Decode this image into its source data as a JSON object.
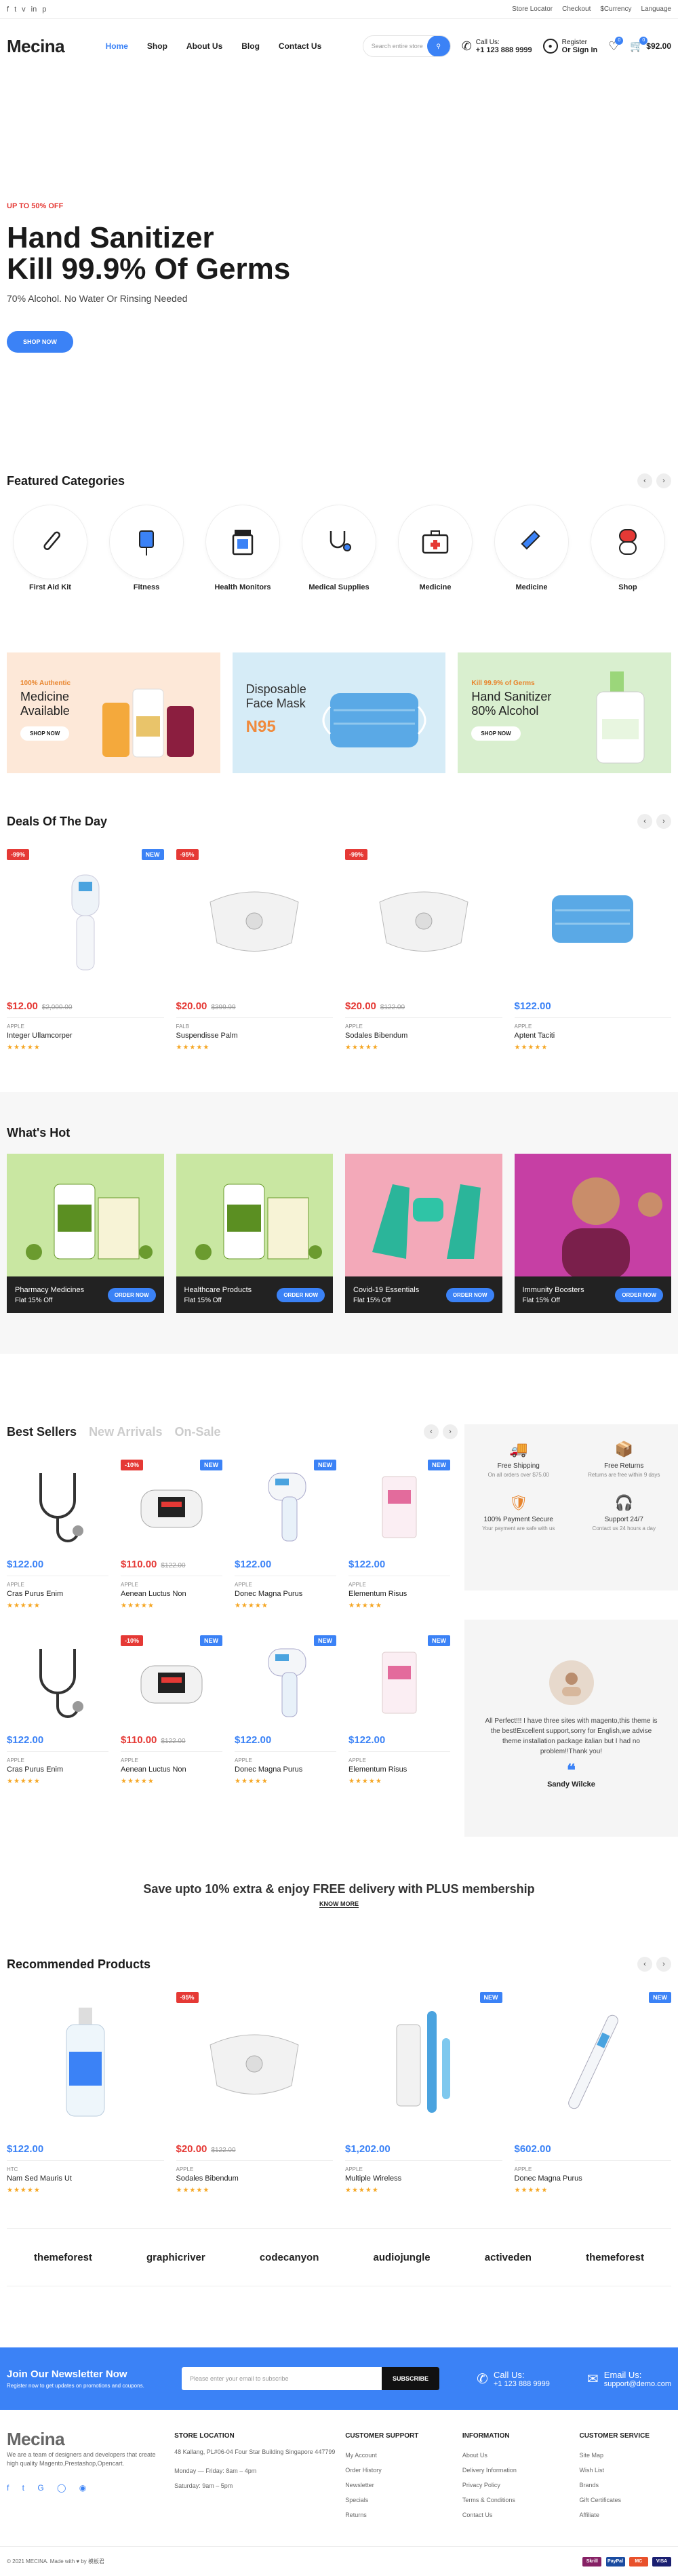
{
  "topbar": {
    "social": [
      "f",
      "t",
      "v",
      "in",
      "p"
    ],
    "store_locator": "Store Locator",
    "checkout": "Checkout",
    "currency": "$Currency",
    "language": "Language"
  },
  "header": {
    "logo": "Mecina",
    "nav": [
      "Home",
      "Shop",
      "About Us",
      "Blog",
      "Contact Us"
    ],
    "search_placeholder": "Search entire store",
    "call_label": "Call Us:",
    "phone": "+1 123 888 9999",
    "register": "Register",
    "signin": "Or Sign In",
    "wishlist_count": "0",
    "cart_count": "0",
    "cart_total": "$92.00"
  },
  "hero": {
    "tag": "UP TO 50% OFF",
    "line1": "Hand Sanitizer",
    "line2": "Kill 99.9% Of Germs",
    "sub": "70% Alcohol. No Water Or Rinsing Needed",
    "button": "SHOP NOW"
  },
  "categories": {
    "title": "Featured Categories",
    "items": [
      "First Aid Kit",
      "Fitness",
      "Health Monitors",
      "Medical Supplies",
      "Medicine",
      "Medicine",
      "Shop"
    ]
  },
  "banners": [
    {
      "tag": "100% Authentic",
      "title": "Medicine Available",
      "button": "SHOP NOW",
      "bg": "#fde8d8"
    },
    {
      "tag": "",
      "title": "Disposable Face Mask",
      "extra": "N95",
      "button": "",
      "bg": "#d6ecf7"
    },
    {
      "tag": "Kill 99.9% of Germs",
      "title": "Hand Sanitizer 80% Alcohol",
      "button": "SHOP NOW",
      "bg": "#d9efcf"
    }
  ],
  "deals": {
    "title": "Deals Of The Day",
    "items": [
      {
        "sale": "-99%",
        "new": "NEW",
        "price": "$12.00",
        "old": "$2,000.00",
        "cat": "APPLE",
        "name": "Integer Ullamcorper",
        "stars": "★★★★★"
      },
      {
        "sale": "-95%",
        "new": "",
        "price": "$20.00",
        "old": "$399.99",
        "cat": "FALB",
        "name": "Suspendisse Palm",
        "stars": "★★★★★"
      },
      {
        "sale": "-99%",
        "new": "",
        "price": "$20.00",
        "old": "$122.00",
        "cat": "APPLE",
        "name": "Sodales Bibendum",
        "stars": "★★★★★"
      },
      {
        "sale": "",
        "new": "",
        "price": "$122.00",
        "old": "",
        "cat": "APPLE",
        "name": "Aptent Taciti",
        "stars": "★★★★★"
      }
    ]
  },
  "hot": {
    "title": "What's Hot",
    "items": [
      {
        "name": "Pharmacy Medicines",
        "off": "Flat 15% Off",
        "button": "ORDER NOW",
        "bg": "#c9e7a2"
      },
      {
        "name": "Healthcare Products",
        "off": "Flat 15% Off",
        "button": "ORDER NOW",
        "bg": "#c9e7a2"
      },
      {
        "name": "Covid-19 Essentials",
        "off": "Flat 15% Off",
        "button": "ORDER NOW",
        "bg": "#f3a9b9"
      },
      {
        "name": "Immunity Boosters",
        "off": "Flat 15% Off",
        "button": "ORDER NOW",
        "bg": "#c63fa4"
      }
    ]
  },
  "bestsellers": {
    "tabs": [
      "Best Sellers",
      "New Arrivals",
      "On-Sale"
    ],
    "items": [
      {
        "sale": "",
        "new": "",
        "price": "$122.00",
        "old": "",
        "cat": "APPLE",
        "name": "Cras Purus Enim",
        "stars": "★★★★★"
      },
      {
        "sale": "-10%",
        "new": "NEW",
        "price": "$110.00",
        "old": "$122.00",
        "cat": "APPLE",
        "name": "Aenean Luctus Non",
        "stars": "★★★★★"
      },
      {
        "sale": "",
        "new": "NEW",
        "price": "$122.00",
        "old": "",
        "cat": "APPLE",
        "name": "Donec Magna Purus",
        "stars": "★★★★★"
      },
      {
        "sale": "",
        "new": "NEW",
        "price": "$122.00",
        "old": "",
        "cat": "APPLE",
        "name": "Elementum Risus",
        "stars": "★★★★★"
      },
      {
        "sale": "",
        "new": "",
        "price": "$122.00",
        "old": "",
        "cat": "APPLE",
        "name": "Cras Purus Enim",
        "stars": "★★★★★"
      },
      {
        "sale": "-10%",
        "new": "NEW",
        "price": "$110.00",
        "old": "$122.00",
        "cat": "APPLE",
        "name": "Aenean Luctus Non",
        "stars": "★★★★★"
      },
      {
        "sale": "",
        "new": "NEW",
        "price": "$122.00",
        "old": "",
        "cat": "APPLE",
        "name": "Donec Magna Purus",
        "stars": "★★★★★"
      },
      {
        "sale": "",
        "new": "NEW",
        "price": "$122.00",
        "old": "",
        "cat": "APPLE",
        "name": "Elementum Risus",
        "stars": "★★★★★"
      }
    ]
  },
  "services": [
    {
      "title": "Free Shipping",
      "sub": "On all orders over $75.00"
    },
    {
      "title": "Free Returns",
      "sub": "Returns are free within 9 days"
    },
    {
      "title": "100% Payment Secure",
      "sub": "Your payment are safe with us"
    },
    {
      "title": "Support 24/7",
      "sub": "Contact us 24 hours a day"
    }
  ],
  "testimonial": {
    "text": "All Perfect!!! I have three sites with magento,this theme is the best!Excellent support,sorry for English,we advise theme installation package italian but I had no problem!!Thank you!",
    "name": "Sandy Wilcke"
  },
  "promo": {
    "text": "Save upto 10% extra & enjoy FREE delivery with PLUS membership",
    "link": "KNOW MORE"
  },
  "recommended": {
    "title": "Recommended Products",
    "items": [
      {
        "sale": "",
        "new": "",
        "price": "$122.00",
        "old": "",
        "cat": "HTC",
        "name": "Nam Sed Mauris Ut",
        "stars": "★★★★★"
      },
      {
        "sale": "-95%",
        "new": "",
        "price": "$20.00",
        "old": "$122.00",
        "cat": "APPLE",
        "name": "Sodales Bibendum",
        "stars": "★★★★★"
      },
      {
        "sale": "",
        "new": "NEW",
        "price": "$1,202.00",
        "old": "",
        "cat": "APPLE",
        "name": "Multiple Wireless",
        "stars": "★★★★★"
      },
      {
        "sale": "",
        "new": "NEW",
        "price": "$602.00",
        "old": "",
        "cat": "APPLE",
        "name": "Donec Magna Purus",
        "stars": "★★★★★"
      }
    ]
  },
  "brands": [
    "themeforest",
    "graphicriver",
    "codecanyon",
    "audiojungle",
    "activeden",
    "themeforest"
  ],
  "newsletter": {
    "title": "Join Our Newsletter Now",
    "sub": "Register now to get updates on promotions and coupons.",
    "placeholder": "Please enter your email to subscribe",
    "button": "SUBSCRIBE",
    "call_label": "Call Us:",
    "phone": "+1 123 888 9999",
    "email_label": "Email Us:",
    "email": "support@demo.com"
  },
  "footer": {
    "logo": "Mecina",
    "about": "We are a team of designers and developers that create high quality Magento,Prestashop,Opencart.",
    "store": {
      "title": "STORE LOCATION",
      "lines": [
        "48 Kallang, PL#06-04 Four Star Building Singapore 447799",
        "Monday — Friday: 8am – 4pm",
        "Saturday: 9am – 5pm"
      ]
    },
    "support": {
      "title": "CUSTOMER SUPPORT",
      "links": [
        "My Account",
        "Order History",
        "Newsletter",
        "Specials",
        "Returns"
      ]
    },
    "info": {
      "title": "INFORMATION",
      "links": [
        "About Us",
        "Delivery Information",
        "Privacy Policy",
        "Terms & Conditions",
        "Contact Us"
      ]
    },
    "service": {
      "title": "CUSTOMER SERVICE",
      "links": [
        "Site Map",
        "Wish List",
        "Brands",
        "Gift Certificates",
        "Affiliate"
      ]
    },
    "copyright": "© 2021 MECINA. Made with ♥ by 模板君",
    "pay": [
      "Skrill",
      "PayPal",
      "MC",
      "VISA"
    ]
  }
}
